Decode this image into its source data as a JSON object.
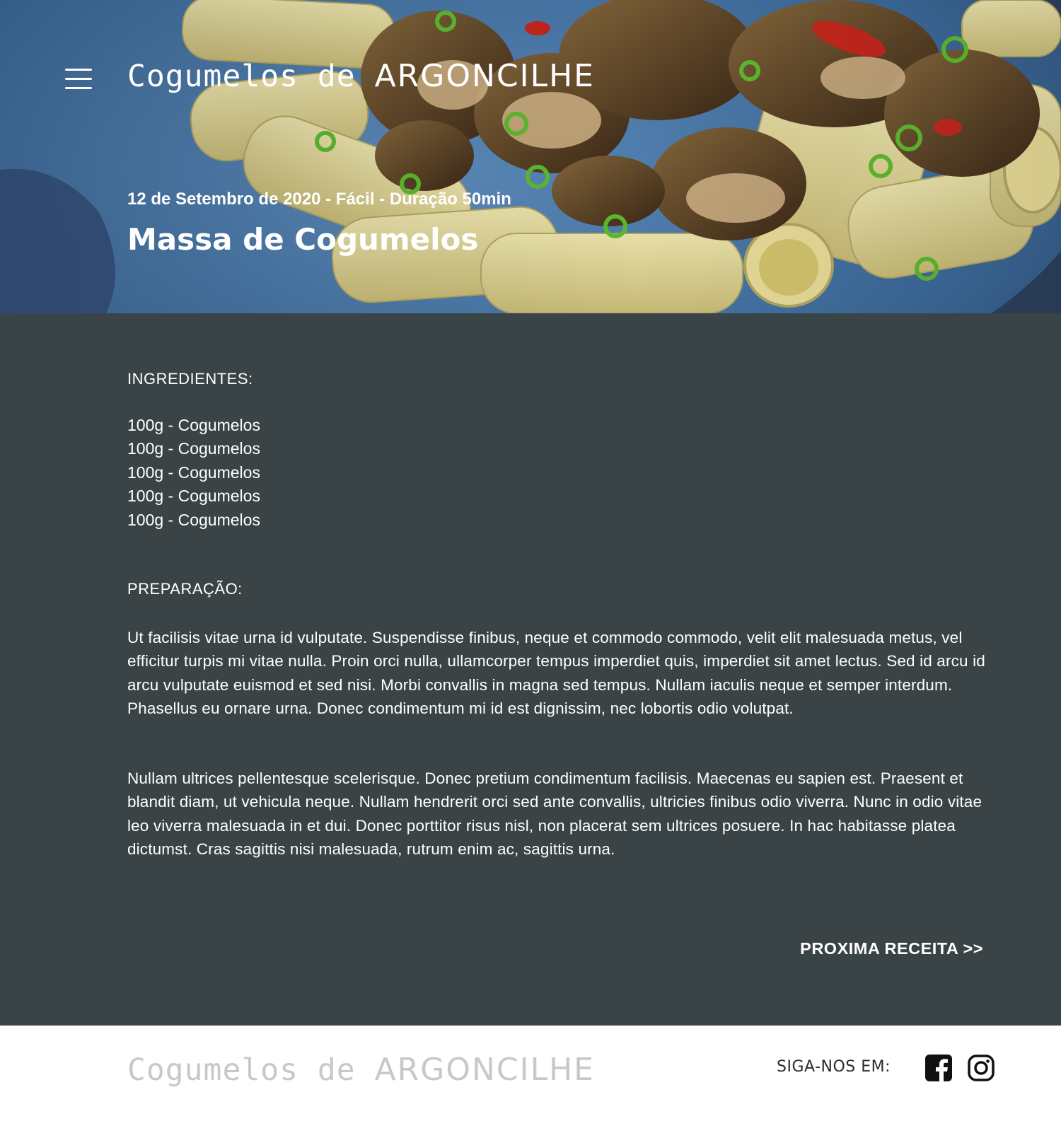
{
  "header": {
    "logo_script": "Cogumelos de",
    "logo_caps": "ARGONCILHE",
    "menu_icon": "hamburger-menu-icon"
  },
  "recipe": {
    "meta": "12 de Setembro de 2020 -  Fácil - Duração 50min",
    "title": "Massa de Cogumelos"
  },
  "ingredients": {
    "heading": "INGREDIENTES:",
    "items": [
      "100g - Cogumelos",
      "100g - Cogumelos",
      "100g - Cogumelos",
      "100g - Cogumelos",
      "100g - Cogumelos"
    ]
  },
  "preparation": {
    "heading": "PREPARAÇÃO:",
    "paragraphs": [
      "Ut facilisis vitae urna id vulputate. Suspendisse finibus, neque et commodo commodo, velit elit malesuada metus, vel efficitur turpis mi vitae nulla. Proin orci nulla, ullamcorper tempus imperdiet quis, imperdiet sit amet lectus. Sed id arcu id arcu vulputate euismod et sed nisi. Morbi convallis in magna sed tempus. Nullam iaculis neque et semper interdum. Phasellus eu ornare urna. Donec condimentum mi id est dignissim, nec lobortis odio volutpat.",
      "Nullam ultrices pellentesque scelerisque. Donec pretium condimentum facilisis. Maecenas eu sapien est. Praesent et blandit diam, ut vehicula neque. Nullam hendrerit orci sed ante convallis, ultricies finibus odio viverra. Nunc in odio vitae leo viverra malesuada in et dui. Donec porttitor risus nisl, non placerat sem ultrices posuere. In hac habitasse platea dictumst. Cras sagittis nisi malesuada, rutrum enim ac, sagittis urna."
    ]
  },
  "navigation": {
    "next_label": "PROXIMA RECEITA >>"
  },
  "footer": {
    "logo_script": "Cogumelos de",
    "logo_caps": "ARGONCILHE",
    "follow_label": "SIGA-NOS EM:",
    "social_icons": [
      "facebook-icon",
      "instagram-icon"
    ]
  },
  "colors": {
    "content_background": "#3a4447",
    "footer_background": "#ffffff",
    "text_light": "#ffffff",
    "footer_logo": "#c8c8c8",
    "footer_text": "#2b2b2b"
  }
}
